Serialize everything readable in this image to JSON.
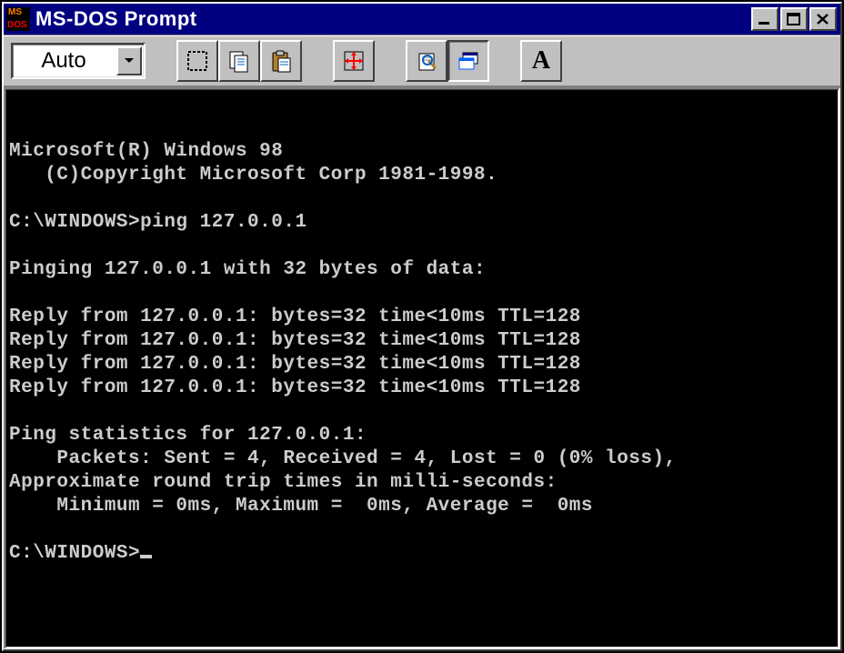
{
  "window": {
    "title": "MS-DOS Prompt",
    "icon_name": "msdos-icon"
  },
  "toolbar": {
    "size_selector": {
      "value": "Auto"
    },
    "buttons": {
      "mark": "mark-icon",
      "copy": "copy-icon",
      "paste": "paste-icon",
      "fullscreen": "fullscreen-icon",
      "properties": "properties-icon",
      "background": "background-icon",
      "font": "A"
    }
  },
  "terminal": {
    "lines": [
      "",
      "Microsoft(R) Windows 98",
      "   (C)Copyright Microsoft Corp 1981-1998.",
      "",
      "C:\\WINDOWS>ping 127.0.0.1",
      "",
      "Pinging 127.0.0.1 with 32 bytes of data:",
      "",
      "Reply from 127.0.0.1: bytes=32 time<10ms TTL=128",
      "Reply from 127.0.0.1: bytes=32 time<10ms TTL=128",
      "Reply from 127.0.0.1: bytes=32 time<10ms TTL=128",
      "Reply from 127.0.0.1: bytes=32 time<10ms TTL=128",
      "",
      "Ping statistics for 127.0.0.1:",
      "    Packets: Sent = 4, Received = 4, Lost = 0 (0% loss),",
      "Approximate round trip times in milli-seconds:",
      "    Minimum = 0ms, Maximum =  0ms, Average =  0ms",
      "",
      "C:\\WINDOWS>_"
    ]
  }
}
